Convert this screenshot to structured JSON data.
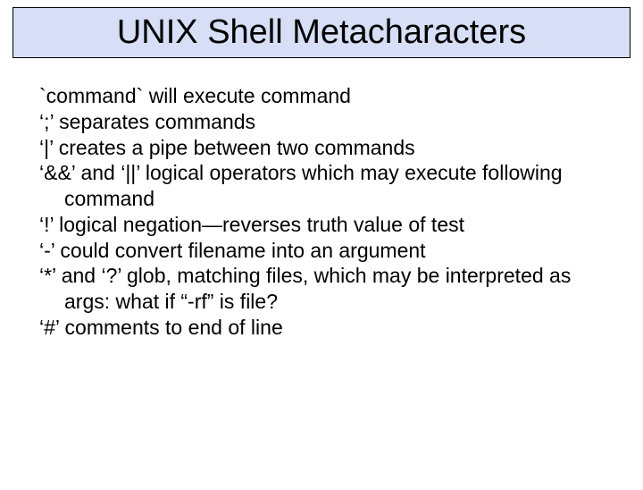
{
  "title": "UNIX Shell Metacharacters",
  "bullets": [
    "`command` will execute command",
    "‘;’ separates commands",
    "‘|’ creates a pipe between two commands",
    "‘&&’ and ‘||’ logical operators which may execute following command",
    "‘!’ logical negation—reverses truth value of test",
    "‘-’ could convert filename into an argument",
    "‘*’ and ‘?’ glob, matching files, which may be interpreted as args: what if “-rf” is file?",
    "‘#’ comments to end of line"
  ]
}
